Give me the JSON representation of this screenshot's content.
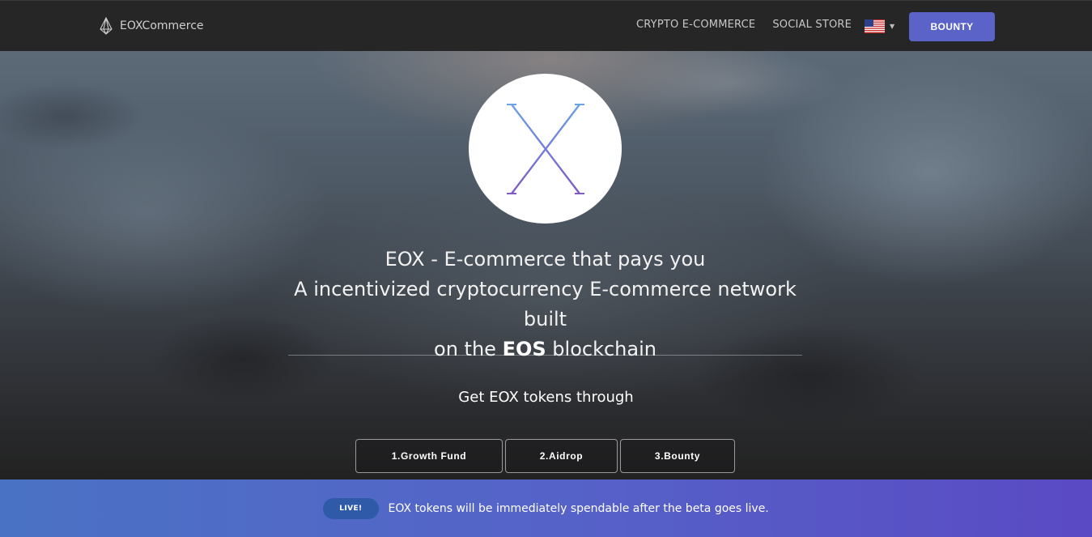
{
  "navbar": {
    "brand_name": "EOXCommerce",
    "links": [
      "CRYPTO E-COMMERCE",
      "SOCIAL STORE"
    ],
    "language_icon": "us-flag-icon",
    "bounty_label": "BOUNTY"
  },
  "hero": {
    "logo_icon": "eox-x-logo",
    "headline_line1": "EOX - E-commerce that pays you",
    "headline_line2": "A incentivized cryptocurrency E-commerce network built",
    "headline_line3_prefix": "on the ",
    "headline_line3_bold": "EOS",
    "headline_line3_suffix": " blockchain",
    "subheading": "Get EOX tokens through",
    "steps": [
      "1.Growth Fund",
      "2.Aidrop",
      "3.Bounty"
    ]
  },
  "banner": {
    "badge": "LIVE!",
    "text": "EOX tokens will be immediately spendable after the beta goes live."
  },
  "colors": {
    "accent": "#5b63c9",
    "navbar_bg": "#262626",
    "banner_start": "#4a72c4",
    "banner_end": "#5a4ac4"
  }
}
